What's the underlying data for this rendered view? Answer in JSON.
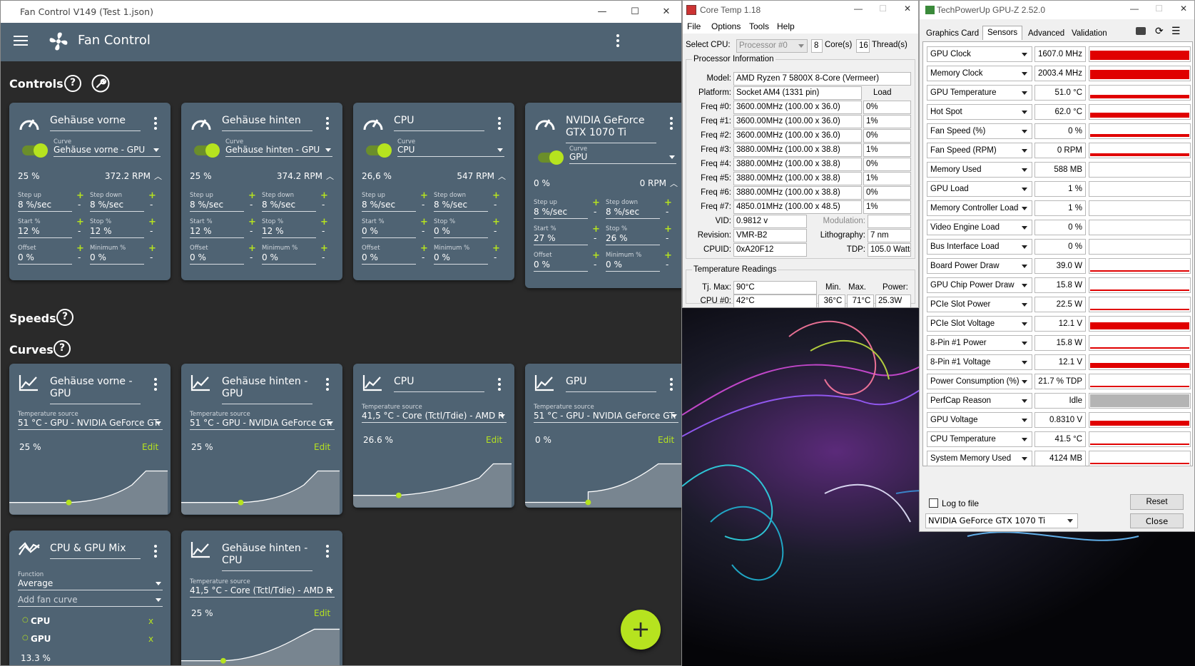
{
  "fancontrol": {
    "window_title": "Fan Control V149 (Test 1.json)",
    "app_title": "Fan Control",
    "sections": {
      "controls": "Controls",
      "speeds": "Speeds",
      "curves": "Curves"
    },
    "controls": [
      {
        "name": "Gehäuse vorne",
        "curve_label": "Curve",
        "curve": "Gehäuse vorne - GPU",
        "percent": "25 %",
        "rpm": "372.2 RPM",
        "step_up": "8 %/sec",
        "step_down": "8 %/sec",
        "start": "12 %",
        "stop": "12 %",
        "offset": "0 %",
        "minimum": "0 %"
      },
      {
        "name": "Gehäuse hinten",
        "curve_label": "Curve",
        "curve": "Gehäuse hinten - GPU",
        "percent": "25 %",
        "rpm": "374.2 RPM",
        "step_up": "8 %/sec",
        "step_down": "8 %/sec",
        "start": "12 %",
        "stop": "12 %",
        "offset": "0 %",
        "minimum": "0 %"
      },
      {
        "name": "CPU",
        "curve_label": "Curve",
        "curve": "CPU",
        "percent": "26,6 %",
        "rpm": "547 RPM",
        "step_up": "8 %/sec",
        "step_down": "8 %/sec",
        "start": "0 %",
        "stop": "0 %",
        "offset": "0 %",
        "minimum": "0 %"
      },
      {
        "name": "NVIDIA GeForce GTX 1070 Ti",
        "curve_label": "Curve",
        "curve": "GPU",
        "percent": "0 %",
        "rpm": "0 RPM",
        "step_up": "8 %/sec",
        "step_down": "8 %/sec",
        "start": "27 %",
        "stop": "26 %",
        "offset": "0 %",
        "minimum": "0 %"
      }
    ],
    "field_labels": {
      "step_up": "Step up",
      "step_down": "Step down",
      "start": "Start %",
      "stop": "Stop %",
      "offset": "Offset",
      "minimum": "Minimum %"
    },
    "curves": [
      {
        "name": "Gehäuse vorne - GPU",
        "src_label": "Temperature source",
        "src": "51 °C - GPU - NVIDIA GeForce GT.",
        "value": "25 %",
        "edit": "Edit"
      },
      {
        "name": "Gehäuse hinten - GPU",
        "src_label": "Temperature source",
        "src": "51 °C - GPU - NVIDIA GeForce GT.",
        "value": "25 %",
        "edit": "Edit"
      },
      {
        "name": "CPU",
        "src_label": "Temperature source",
        "src": "41,5 °C - Core (Tctl/Tdie) - AMD R",
        "value": "26.6 %",
        "edit": "Edit"
      },
      {
        "name": "GPU",
        "src_label": "Temperature source",
        "src": "51 °C - GPU - NVIDIA GeForce GT.",
        "value": "0 %",
        "edit": "Edit"
      }
    ],
    "mix": {
      "name": "CPU & GPU Mix",
      "func_label": "Function",
      "func": "Average",
      "add": "Add fan curve",
      "items": [
        "CPU",
        "GPU"
      ],
      "remove": "x",
      "value": "13.3 %"
    },
    "curve5": {
      "name": "Gehäuse hinten - CPU",
      "src_label": "Temperature source",
      "src": "41,5 °C - Core (Tctl/Tdie) - AMD R",
      "value": "25 %",
      "edit": "Edit"
    },
    "fab": "+"
  },
  "coretemp": {
    "title": "Core Temp 1.18",
    "menu": [
      "File",
      "Options",
      "Tools",
      "Help"
    ],
    "select_cpu": "Select CPU:",
    "processor": "Processor #0",
    "cores": "8",
    "cores_label": "Core(s)",
    "threads": "16",
    "threads_label": "Thread(s)",
    "proc_info": "Processor Information",
    "model_label": "Model:",
    "model": "AMD Ryzen 7 5800X 8-Core (Vermeer)",
    "platform_label": "Platform:",
    "platform": "Socket AM4 (1331 pin)",
    "load_label": "Load",
    "freqs": [
      {
        "label": "Freq #0:",
        "value": "3600.00MHz (100.00 x 36.0)",
        "load": "0%"
      },
      {
        "label": "Freq #1:",
        "value": "3600.00MHz (100.00 x 36.0)",
        "load": "1%"
      },
      {
        "label": "Freq #2:",
        "value": "3600.00MHz (100.00 x 36.0)",
        "load": "0%"
      },
      {
        "label": "Freq #3:",
        "value": "3880.00MHz (100.00 x 38.8)",
        "load": "1%"
      },
      {
        "label": "Freq #4:",
        "value": "3880.00MHz (100.00 x 38.8)",
        "load": "0%"
      },
      {
        "label": "Freq #5:",
        "value": "3880.00MHz (100.00 x 38.8)",
        "load": "1%"
      },
      {
        "label": "Freq #6:",
        "value": "3880.00MHz (100.00 x 38.8)",
        "load": "0%"
      },
      {
        "label": "Freq #7:",
        "value": "4850.01MHz (100.00 x 48.5)",
        "load": "1%"
      }
    ],
    "vid_label": "VID:",
    "vid": "0.9812 v",
    "modulation_label": "Modulation:",
    "revision_label": "Revision:",
    "revision": "VMR-B2",
    "litho_label": "Lithography:",
    "litho": "7 nm",
    "cpuid_label": "CPUID:",
    "cpuid": "0xA20F12",
    "tdp_label": "TDP:",
    "tdp": "105.0 Watts",
    "temp_readings": "Temperature Readings",
    "tjmax_label": "Tj. Max:",
    "tjmax": "90°C",
    "min_label": "Min.",
    "max_label": "Max.",
    "power_label": "Power:",
    "cpu0_label": "CPU #0:",
    "cpu0": "42°C",
    "cpu0_min": "36°C",
    "cpu0_max": "71°C",
    "cpu0_power": "25.3W"
  },
  "gpuz": {
    "title": "TechPowerUp GPU-Z 2.52.0",
    "tabs": [
      "Graphics Card",
      "Sensors",
      "Advanced",
      "Validation"
    ],
    "sensors": [
      {
        "name": "GPU Clock",
        "value": "1607.0 MHz",
        "level": 0.82
      },
      {
        "name": "Memory Clock",
        "value": "2003.4 MHz",
        "level": 0.82
      },
      {
        "name": "GPU Temperature",
        "value": "51.0 °C",
        "level": 0.3
      },
      {
        "name": "Hot Spot",
        "value": "62.0 °C",
        "level": 0.45
      },
      {
        "name": "Fan Speed (%)",
        "value": "0 %",
        "level": 0.22
      },
      {
        "name": "Fan Speed (RPM)",
        "value": "0 RPM",
        "level": 0.22
      },
      {
        "name": "Memory Used",
        "value": "588 MB",
        "level": 0
      },
      {
        "name": "GPU Load",
        "value": "1 %",
        "level": 0
      },
      {
        "name": "Memory Controller Load",
        "value": "1 %",
        "level": 0
      },
      {
        "name": "Video Engine Load",
        "value": "0 %",
        "level": 0
      },
      {
        "name": "Bus Interface Load",
        "value": "0 %",
        "level": 0
      },
      {
        "name": "Board Power Draw",
        "value": "39.0 W",
        "level": 0.08
      },
      {
        "name": "GPU Chip Power Draw",
        "value": "15.8 W",
        "level": 0.06
      },
      {
        "name": "PCIe Slot Power",
        "value": "22.5 W",
        "level": 0.15
      },
      {
        "name": "PCIe Slot Voltage",
        "value": "12.1 V",
        "level": 0.65
      },
      {
        "name": "8-Pin #1 Power",
        "value": "15.8 W",
        "level": 0.06
      },
      {
        "name": "8-Pin #1 Voltage",
        "value": "12.1 V",
        "level": 0.45
      },
      {
        "name": "Power Consumption (%)",
        "value": "21.7 % TDP",
        "level": 0.08
      },
      {
        "name": "PerfCap Reason",
        "value": "Idle",
        "level": 1
      },
      {
        "name": "GPU Voltage",
        "value": "0.8310 V",
        "level": 0.45
      },
      {
        "name": "CPU Temperature",
        "value": "41.5 °C",
        "level": 0.06
      },
      {
        "name": "System Memory Used",
        "value": "4124 MB",
        "level": 0.04
      }
    ],
    "log": "Log to file",
    "reset": "Reset",
    "gpu_select": "NVIDIA GeForce GTX 1070 Ti",
    "close": "Close",
    "bar_color": "#e00000",
    "perfcap_color": "#b4b4b4"
  }
}
